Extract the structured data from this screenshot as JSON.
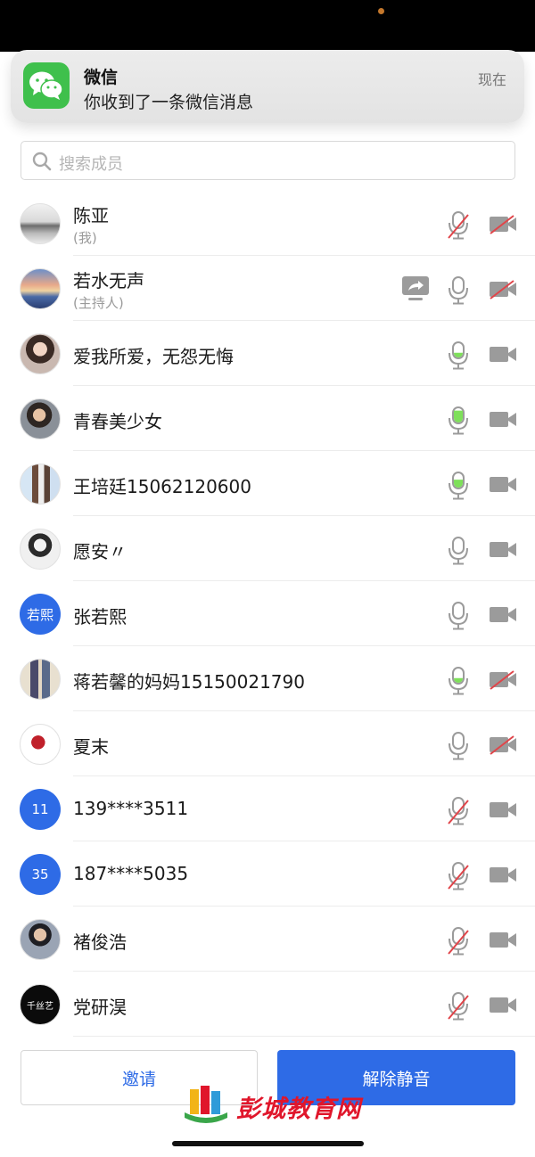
{
  "notification": {
    "app": "微信",
    "message": "你收到了一条微信消息",
    "time": "现在"
  },
  "search": {
    "placeholder": "搜索成员"
  },
  "members": [
    {
      "name": "陈亚",
      "role": "(我)",
      "avatar": "landscape-bw",
      "mic": "muted",
      "camera": "off"
    },
    {
      "name": "若水无声",
      "role": "(主持人)",
      "avatar": "sunset",
      "mic": "on",
      "camera": "off",
      "sharing": true
    },
    {
      "name": "爱我所爱，无怨无悔",
      "role": "",
      "avatar": "portrait-woman",
      "mic": "speaking-low",
      "camera": "on"
    },
    {
      "name": "青春美少女",
      "role": "",
      "avatar": "portrait-girl",
      "mic": "speaking-high",
      "camera": "on"
    },
    {
      "name": "王培廷15062120600",
      "role": "",
      "avatar": "couple-photo",
      "mic": "speaking-mid",
      "camera": "on"
    },
    {
      "name": "愿安〃",
      "role": "",
      "avatar": "portrait-sketch",
      "mic": "on",
      "camera": "on"
    },
    {
      "name": "张若熙",
      "role": "",
      "avatar_text": "若熙",
      "mic": "on",
      "camera": "on"
    },
    {
      "name": "蒋若馨的妈妈15150021790",
      "role": "",
      "avatar": "kids-photo",
      "mic": "speaking-low",
      "camera": "off"
    },
    {
      "name": "夏末",
      "role": "",
      "avatar": "red-figure",
      "mic": "on",
      "camera": "off"
    },
    {
      "name": "139****3511",
      "role": "",
      "avatar_text": "11",
      "mic": "muted",
      "camera": "on"
    },
    {
      "name": "187****5035",
      "role": "",
      "avatar_text": "35",
      "mic": "muted",
      "camera": "on"
    },
    {
      "name": "褚俊浩",
      "role": "",
      "avatar": "portrait-man",
      "mic": "muted",
      "camera": "on"
    },
    {
      "name": "党研淏",
      "role": "",
      "avatar": "black-logo",
      "avatar_logo_text": "千丝艺",
      "mic": "muted",
      "camera": "on"
    }
  ],
  "buttons": {
    "invite": "邀请",
    "unmute": "解除静音"
  },
  "watermark": "彭城教育网",
  "colors": {
    "accent": "#2e6be6",
    "speaking": "#7ee05a",
    "muted_slash": "#e0454a",
    "icon_gray": "#9b9b9b"
  }
}
